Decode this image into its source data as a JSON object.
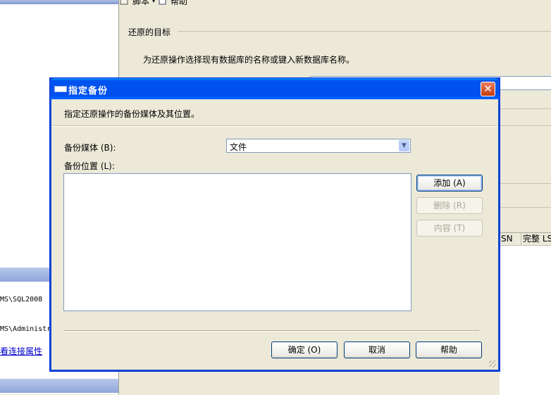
{
  "background": {
    "left_pane": {
      "server_text": "MS\\SQL2008",
      "user_text": "MS\\Administr",
      "link_text": "看连接属性"
    },
    "toolbar": {
      "script_label": "脚本",
      "help_label": "帮助"
    },
    "restore_target": {
      "section_title": "还原的目标",
      "instruction": "为还原操作选择现有数据库的名称或键入新数据库名称。"
    },
    "grid_columns": [
      "SN",
      "完整 LS"
    ]
  },
  "dialog": {
    "title": "指定备份",
    "close_glyph": "✕",
    "instruction": "指定还原操作的备份媒体及其位置。",
    "media_label": "备份媒体 (B):",
    "media_value": "文件",
    "dropdown_glyph": "▼",
    "location_label": "备份位置 (L):",
    "buttons": {
      "add": "添加 (A)",
      "delete": "删除 (R)",
      "contents": "内容 (T)",
      "ok": "确定 (O)",
      "cancel": "取消",
      "help": "帮助"
    }
  },
  "colors": {
    "titlebar": "#0053ee",
    "close_button": "#d44b22",
    "dialog_bg": "#ece9d8",
    "link": "#0000cc"
  },
  "icons": {
    "title": "window-icon",
    "close": "close-icon",
    "dropdown": "chevron-down-icon",
    "resize": "resize-grip-icon"
  }
}
